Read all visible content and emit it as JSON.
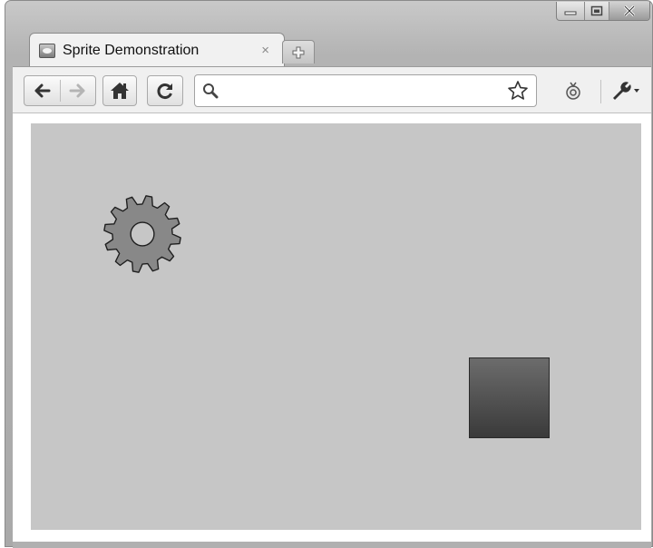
{
  "window": {
    "caption_buttons": {
      "minimize_icon": "minimize-icon",
      "maximize_icon": "maximize-icon",
      "close_icon": "close-x-icon"
    }
  },
  "tabs": [
    {
      "title": "Sprite Demonstration",
      "favicon": "page-favicon-icon",
      "close_glyph": "×",
      "active": true
    }
  ],
  "new_tab": {
    "icon": "plus-icon"
  },
  "toolbar": {
    "back_icon": "arrow-left-icon",
    "forward_icon": "arrow-right-icon",
    "forward_enabled": false,
    "home_icon": "house-icon",
    "reload_icon": "reload-icon",
    "omnibox": {
      "value": "",
      "placeholder": "",
      "search_icon": "magnifier-icon",
      "bookmark_icon": "star-icon"
    },
    "extension_icon": "extension-icon",
    "settings_icon": "wrench-icon"
  },
  "page": {
    "canvas_background": "#c6c6c6",
    "sprites": [
      {
        "name": "gear-sprite",
        "color": "#888888",
        "shape": "gear"
      },
      {
        "name": "square-sprite",
        "color": "#4f4f4f",
        "shape": "square"
      }
    ]
  }
}
